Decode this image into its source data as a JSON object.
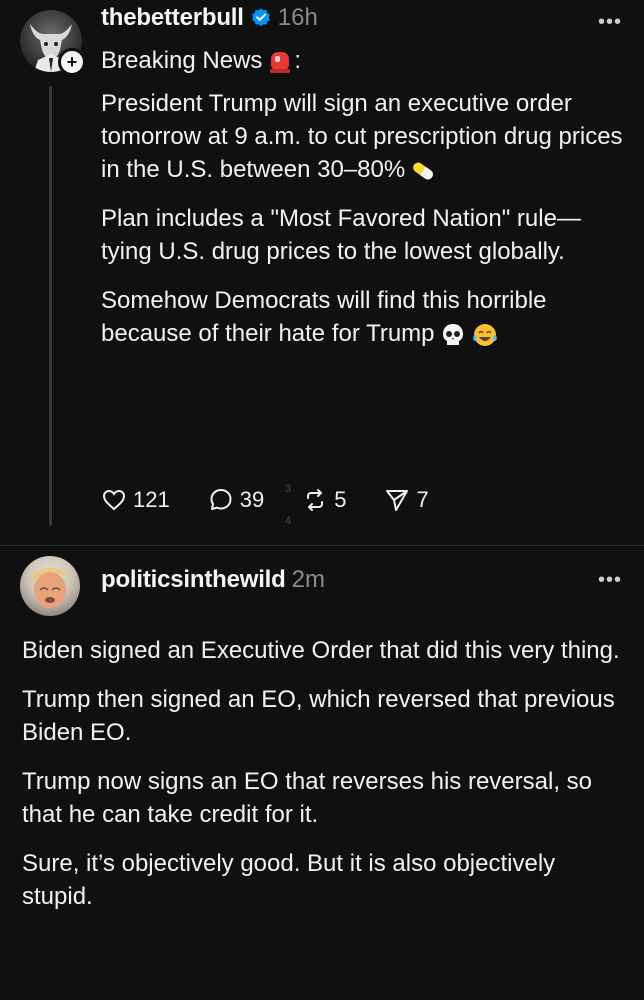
{
  "post": {
    "username": "thebetterbull",
    "time": "16h",
    "more": "•••",
    "follow": "+",
    "paragraphs": [
      "Breaking News",
      "President Trump will sign an executive order tomorrow at 9 a.m. to cut prescription drug prices in the U.S. between 30–80%",
      "Plan includes a \"Most Favored Nation\" rule—tying U.S. drug prices to the lowest globally.",
      "Somehow Democrats will find this horrible because of their hate for Trump"
    ],
    "after_first": ":",
    "likes": "121",
    "replies": "39",
    "reposts": "5",
    "shares": "7",
    "stray_digits": [
      "3",
      "4"
    ],
    "icons": {
      "siren": "siren-emoji",
      "pill": "pill-emoji",
      "skull": "skull-emoji",
      "laugh": "tears-of-joy-emoji"
    }
  },
  "reply": {
    "username": "politicsinthewild",
    "time": "2m",
    "more": "•••",
    "paragraphs": [
      "Biden signed an Executive Order that did this very thing.",
      "Trump then signed an EO, which reversed that previous Biden EO.",
      "Trump now signs an EO that reverses his reversal, so that he can take credit for it.",
      "Sure, it’s objectively good. But it is also objectively stupid."
    ]
  },
  "colors": {
    "background": "#101010",
    "text": "#f2f2f2",
    "muted": "#8a8a8a",
    "verified": "#0095f6"
  }
}
